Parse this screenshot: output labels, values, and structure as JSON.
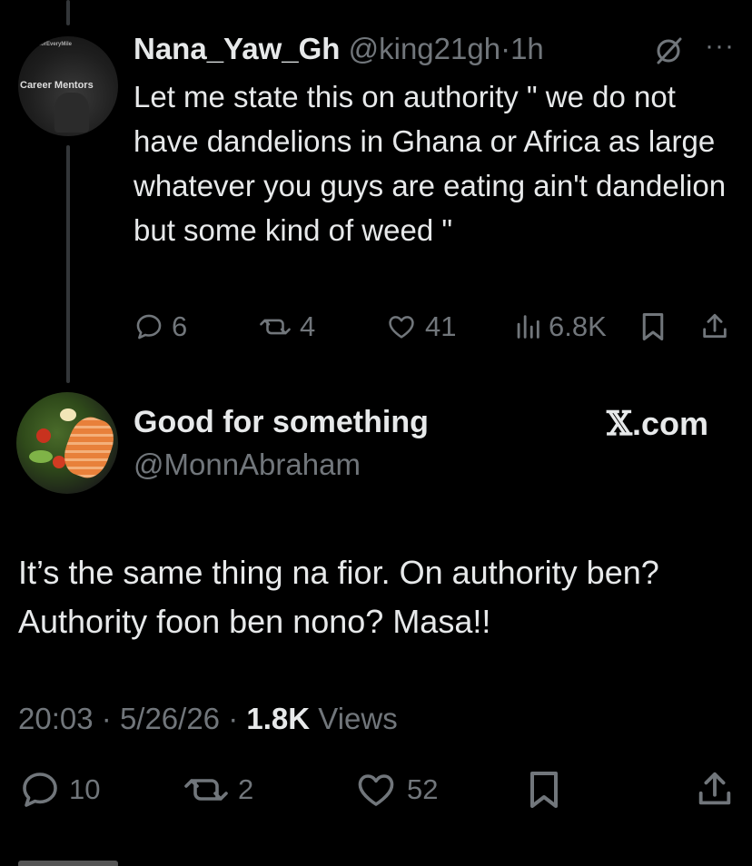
{
  "parent_tweet": {
    "avatar_brand_top": "...forEveryMile",
    "avatar_brand": "Career Mentors",
    "name": "Nana_Yaw_Gh",
    "handle": "@king21gh",
    "separator": "·",
    "time": "1h",
    "more": "···",
    "text": "Let me state this on authority \" we do not have dandelions in Ghana or Africa as large whatever you guys are eating ain't dandelion but some kind of weed \"",
    "replies": "6",
    "reposts": "4",
    "likes": "41",
    "views": "6.8K"
  },
  "main_tweet": {
    "name": "Good for something",
    "handle": "@MonnAbraham",
    "watermark_prefix": "𝕏",
    "watermark_suffix": ".com",
    "text": "It’s the same thing na fior. On authority ben? Authority foon ben nono? Masa!!",
    "time": "20:03",
    "separator": "·",
    "date": "5/26/26",
    "views_count": "1.8K",
    "views_label": "Views",
    "replies": "10",
    "reposts": "2",
    "likes": "52"
  },
  "colors": {
    "background": "#000000",
    "text": "#e7e9ea",
    "secondary": "#71767b",
    "thread_line": "#333639"
  }
}
